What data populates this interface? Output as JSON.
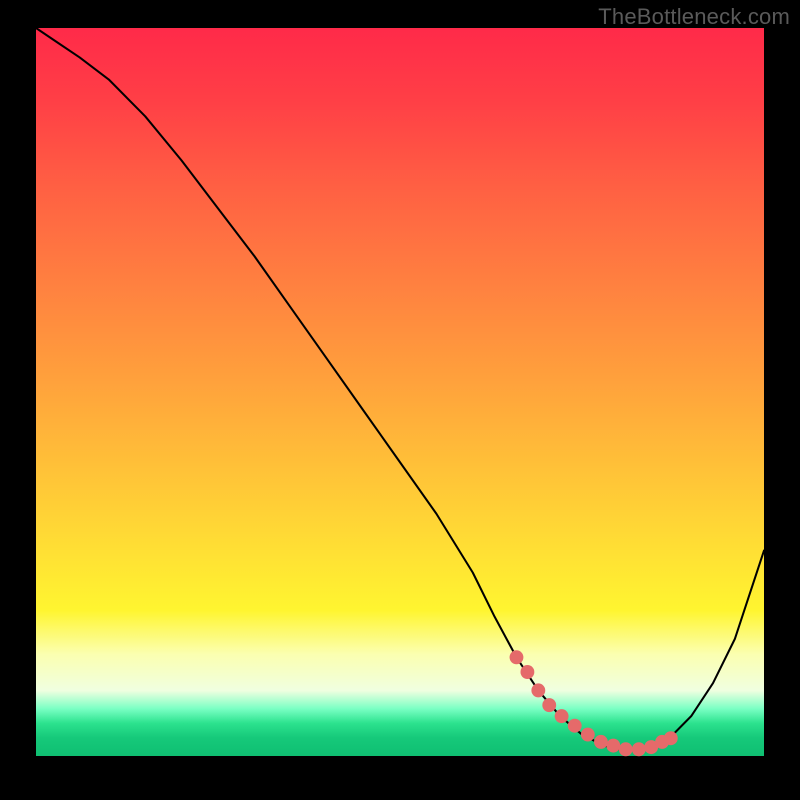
{
  "watermark": "TheBottleneck.com",
  "colors": {
    "curve": "#000000",
    "dots": "#e56a6a",
    "frame": "#000000"
  },
  "gradient_stops": [
    {
      "offset": 0.0,
      "color": "#ff2a49"
    },
    {
      "offset": 0.1,
      "color": "#ff3f46"
    },
    {
      "offset": 0.22,
      "color": "#ff6043"
    },
    {
      "offset": 0.35,
      "color": "#ff8040"
    },
    {
      "offset": 0.48,
      "color": "#ffa03c"
    },
    {
      "offset": 0.6,
      "color": "#ffc038"
    },
    {
      "offset": 0.72,
      "color": "#ffe034"
    },
    {
      "offset": 0.8,
      "color": "#fff530"
    },
    {
      "offset": 0.86,
      "color": "#fbffb0"
    },
    {
      "offset": 0.91,
      "color": "#f0ffe0"
    },
    {
      "offset": 0.935,
      "color": "#7affc4"
    },
    {
      "offset": 0.955,
      "color": "#2ce28e"
    },
    {
      "offset": 0.975,
      "color": "#16c97a"
    },
    {
      "offset": 1.0,
      "color": "#0fbf72"
    }
  ],
  "chart_data": {
    "type": "line",
    "title": "",
    "xlabel": "",
    "ylabel": "",
    "xlim": [
      0,
      100
    ],
    "ylim": [
      0,
      100
    ],
    "series": [
      {
        "name": "bottleneck-curve",
        "x": [
          0,
          3,
          6,
          10,
          15,
          20,
          25,
          30,
          35,
          40,
          45,
          50,
          55,
          60,
          63,
          66,
          69,
          72,
          75,
          78,
          80,
          82,
          84,
          87,
          90,
          93,
          96,
          98,
          100
        ],
        "y": [
          100,
          98,
          96,
          93,
          88,
          82,
          75.5,
          69,
          62,
          55,
          48,
          41,
          34,
          26,
          20,
          14.5,
          10,
          6.5,
          4,
          2.5,
          2,
          2,
          2.3,
          3.5,
          6.5,
          11,
          17,
          23,
          29
        ]
      }
    ],
    "valley_dots": {
      "name": "optimal-range",
      "x": [
        66.0,
        67.5,
        69.0,
        70.5,
        72.2,
        74.0,
        75.8,
        77.6,
        79.3,
        81.0,
        82.8,
        84.5,
        86.0,
        87.2
      ],
      "y": [
        14.5,
        12.5,
        10.0,
        8.0,
        6.5,
        5.2,
        4.0,
        3.0,
        2.5,
        2.0,
        2.0,
        2.3,
        3.0,
        3.5
      ]
    }
  }
}
